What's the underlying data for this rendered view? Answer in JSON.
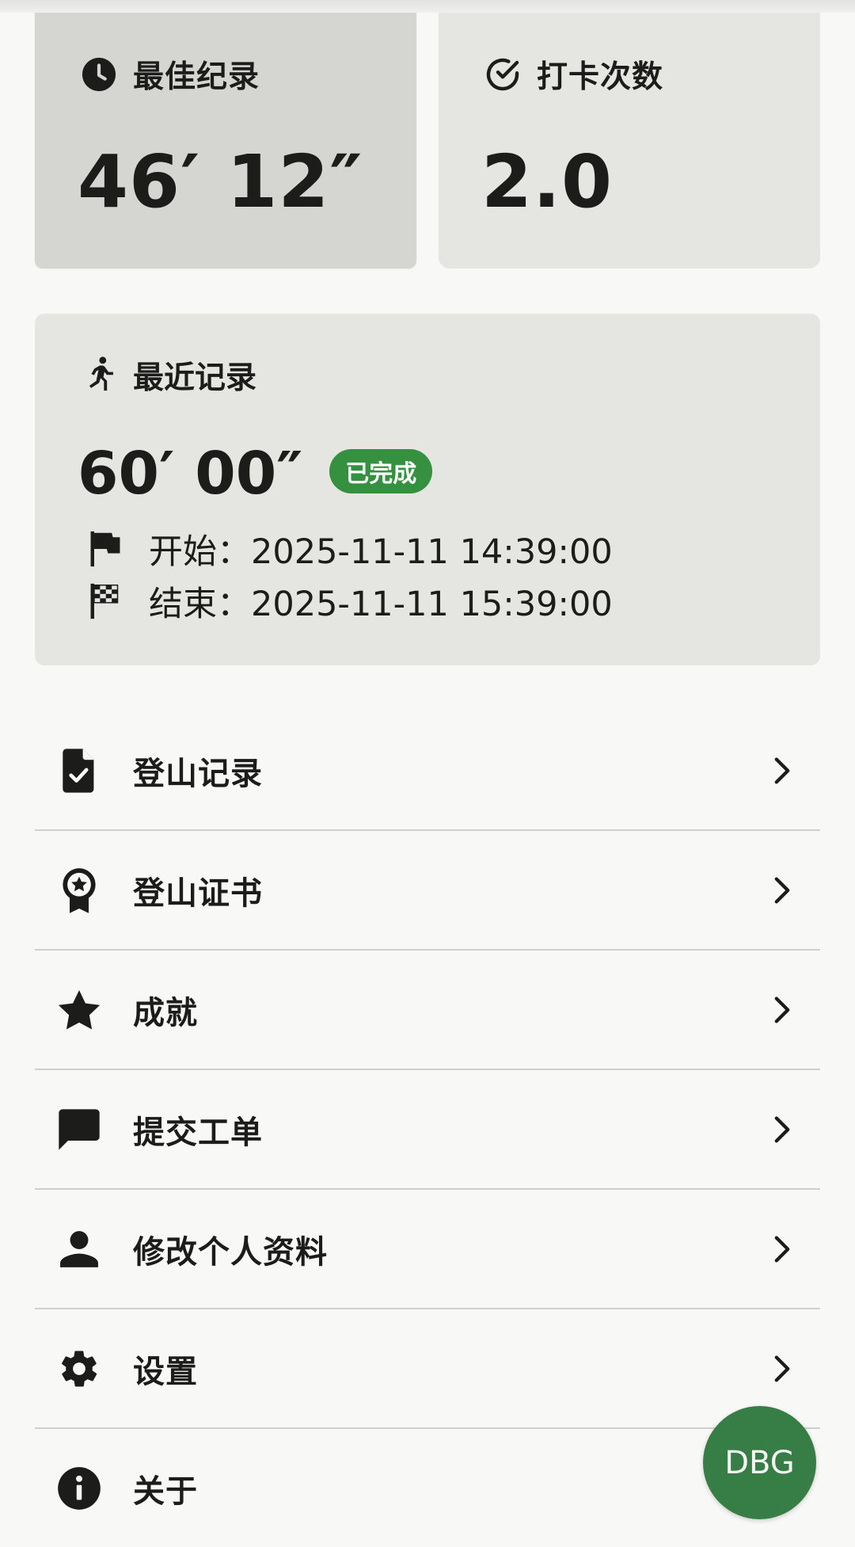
{
  "stats": {
    "best": {
      "label": "最佳纪录",
      "value": "46′ 12″",
      "icon": "clock-icon"
    },
    "checkin": {
      "label": "打卡次数",
      "value": "2.0",
      "icon": "check-circle-icon"
    }
  },
  "recent": {
    "label": "最近记录",
    "icon": "running-person-icon",
    "value": "60′ 00″",
    "status": "已完成",
    "start": "开始：2025-11-11 14:39:00",
    "end": "结束：2025-11-11 15:39:00"
  },
  "menu": {
    "items": [
      {
        "label": "登山记录",
        "icon": "document-check-icon"
      },
      {
        "label": "登山证书",
        "icon": "award-ribbon-icon"
      },
      {
        "label": "成就",
        "icon": "star-icon"
      },
      {
        "label": "提交工单",
        "icon": "chat-bubble-icon"
      },
      {
        "label": "修改个人资料",
        "icon": "person-icon"
      },
      {
        "label": "设置",
        "icon": "gear-icon"
      },
      {
        "label": "关于",
        "icon": "info-icon"
      }
    ]
  },
  "fab": {
    "label": "DBG"
  },
  "colors": {
    "badge_green": "#35903f",
    "fab_green": "#367d46",
    "card_bg": "#e5e5e2",
    "card_pressed_bg": "#d5d5d1"
  }
}
